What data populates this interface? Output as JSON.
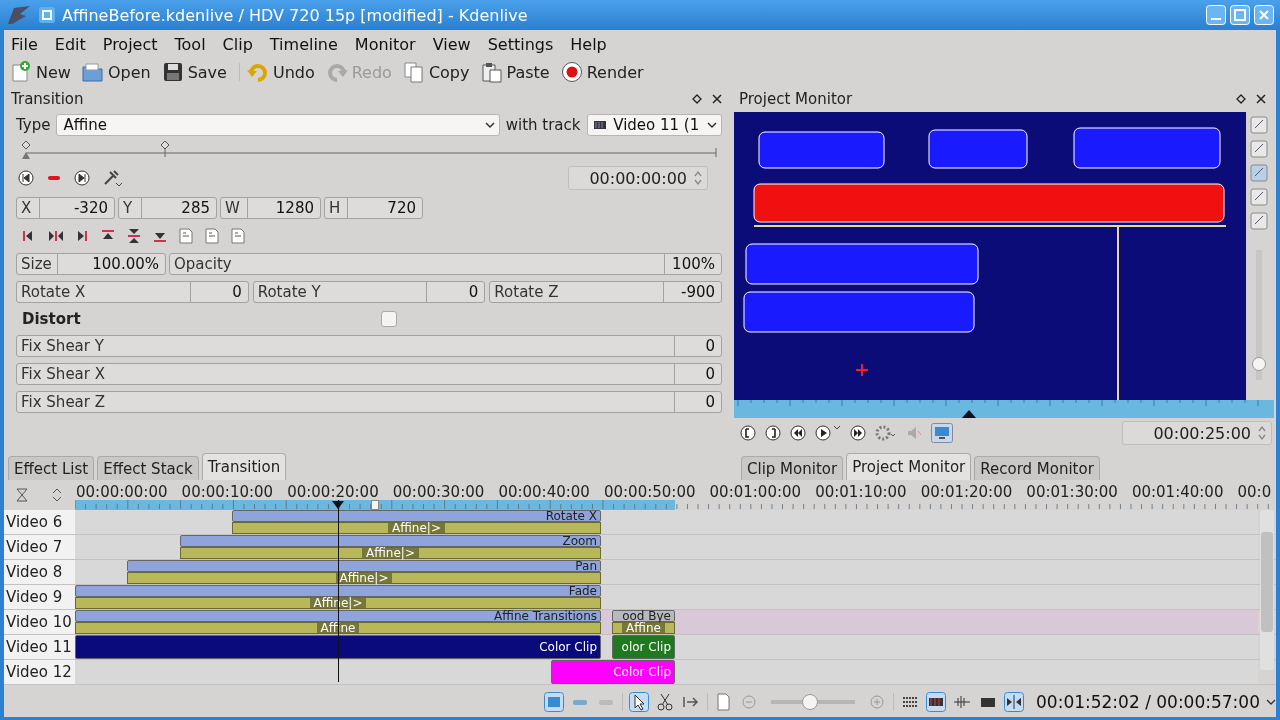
{
  "window": {
    "title": "AffineBefore.kdenlive / HDV 720 15p [modified] - Kdenlive"
  },
  "menu": [
    {
      "label": "File"
    },
    {
      "label": "Edit"
    },
    {
      "label": "Project"
    },
    {
      "label": "Tool"
    },
    {
      "label": "Clip"
    },
    {
      "label": "Timeline"
    },
    {
      "label": "Monitor"
    },
    {
      "label": "View"
    },
    {
      "label": "Settings"
    },
    {
      "label": "Help"
    }
  ],
  "toolbar": [
    {
      "label": "New",
      "disabled": false
    },
    {
      "label": "Open",
      "disabled": false
    },
    {
      "label": "Save",
      "disabled": false
    },
    {
      "label": "Undo",
      "disabled": false
    },
    {
      "label": "Redo",
      "disabled": true
    },
    {
      "label": "Copy",
      "disabled": false
    },
    {
      "label": "Paste",
      "disabled": false
    },
    {
      "label": "Render",
      "disabled": false
    }
  ],
  "transition": {
    "title": "Transition",
    "type_label": "Type",
    "type_value": "Affine",
    "track_label": "with track",
    "track_value": "Video 11 (1",
    "timecode": "00:00:00:00",
    "geometry": [
      {
        "label": "X",
        "value": "-320"
      },
      {
        "label": "Y",
        "value": "285"
      },
      {
        "label": "W",
        "value": "1280"
      },
      {
        "label": "H",
        "value": "720"
      }
    ],
    "size": {
      "label": "Size",
      "value": "100.00%"
    },
    "opacity": {
      "label": "Opacity",
      "value": "100%"
    },
    "rotations": [
      {
        "label": "Rotate X",
        "value": "0"
      },
      {
        "label": "Rotate Y",
        "value": "0"
      },
      {
        "label": "Rotate Z",
        "value": "-900"
      }
    ],
    "distort": {
      "label": "Distort",
      "checked": false
    },
    "shears": [
      {
        "label": "Fix Shear Y",
        "value": "0"
      },
      {
        "label": "Fix Shear X",
        "value": "0"
      },
      {
        "label": "Fix Shear Z",
        "value": "0"
      }
    ]
  },
  "monitor": {
    "title": "Project Monitor",
    "timecode": "00:00:25:00",
    "zoom": {
      "level": 0.08
    },
    "playhead": {
      "level": 0.44
    }
  },
  "left_tabs": [
    {
      "label": "Effect List",
      "selected": false
    },
    {
      "label": "Effect Stack",
      "selected": false
    },
    {
      "label": "Transition",
      "selected": true
    }
  ],
  "right_tabs": [
    {
      "label": "Clip Monitor",
      "selected": false
    },
    {
      "label": "Project Monitor",
      "selected": true
    },
    {
      "label": "Record Monitor",
      "selected": false
    }
  ],
  "timeline": {
    "ruler": [
      "00:00:00:00",
      "00:00:10:00",
      "00:00:20:00",
      "00:00:30:00",
      "00:00:40:00",
      "00:00:50:00",
      "00:01:00:00",
      "00:01:10:00",
      "00:01:20:00",
      "00:01:30:00",
      "00:01:40:00",
      "00:0"
    ],
    "playhead": {
      "level": 0.222
    },
    "tracks": [
      {
        "name": "Video 6",
        "selected": false,
        "clips": [
          {
            "label": "Rotate X",
            "color": "#8ea4da"
          }
        ],
        "transitions": [
          {
            "label": "Affine|>"
          }
        ]
      },
      {
        "name": "Video 7",
        "selected": false,
        "clips": [
          {
            "label": "Zoom",
            "color": "#8ea4da"
          }
        ],
        "transitions": [
          {
            "label": "Affine|>"
          }
        ]
      },
      {
        "name": "Video 8",
        "selected": false,
        "clips": [
          {
            "label": "Pan",
            "color": "#8ea4da"
          }
        ],
        "transitions": [
          {
            "label": "Affine|>"
          }
        ]
      },
      {
        "name": "Video 9",
        "selected": false,
        "clips": [
          {
            "label": "Fade",
            "color": "#8ea4da"
          }
        ],
        "transitions": [
          {
            "label": "Affine|>"
          }
        ]
      },
      {
        "name": "Video 10",
        "selected": true,
        "clips": [
          {
            "label": "Affine Transitions",
            "color": "#8ea4da"
          },
          {
            "label": "ood Bye",
            "color": "#b8b8c0"
          }
        ],
        "transitions": [
          {
            "label": "Affine"
          },
          {
            "label": "Affine"
          }
        ]
      },
      {
        "name": "Video 11",
        "selected": false,
        "clips": [
          {
            "label": "Color Clip",
            "color": "#0a0a7c"
          },
          {
            "label": "olor Clip",
            "color": "#1f7a1f"
          }
        ]
      },
      {
        "name": "Video 12",
        "selected": false,
        "clips": [
          {
            "label": "Color Clip",
            "color": "#ff00ff"
          }
        ]
      }
    ]
  },
  "status": {
    "zoom": {
      "level": 0.45
    },
    "timecode": "00:01:52:02 / 00:00:57:00"
  }
}
